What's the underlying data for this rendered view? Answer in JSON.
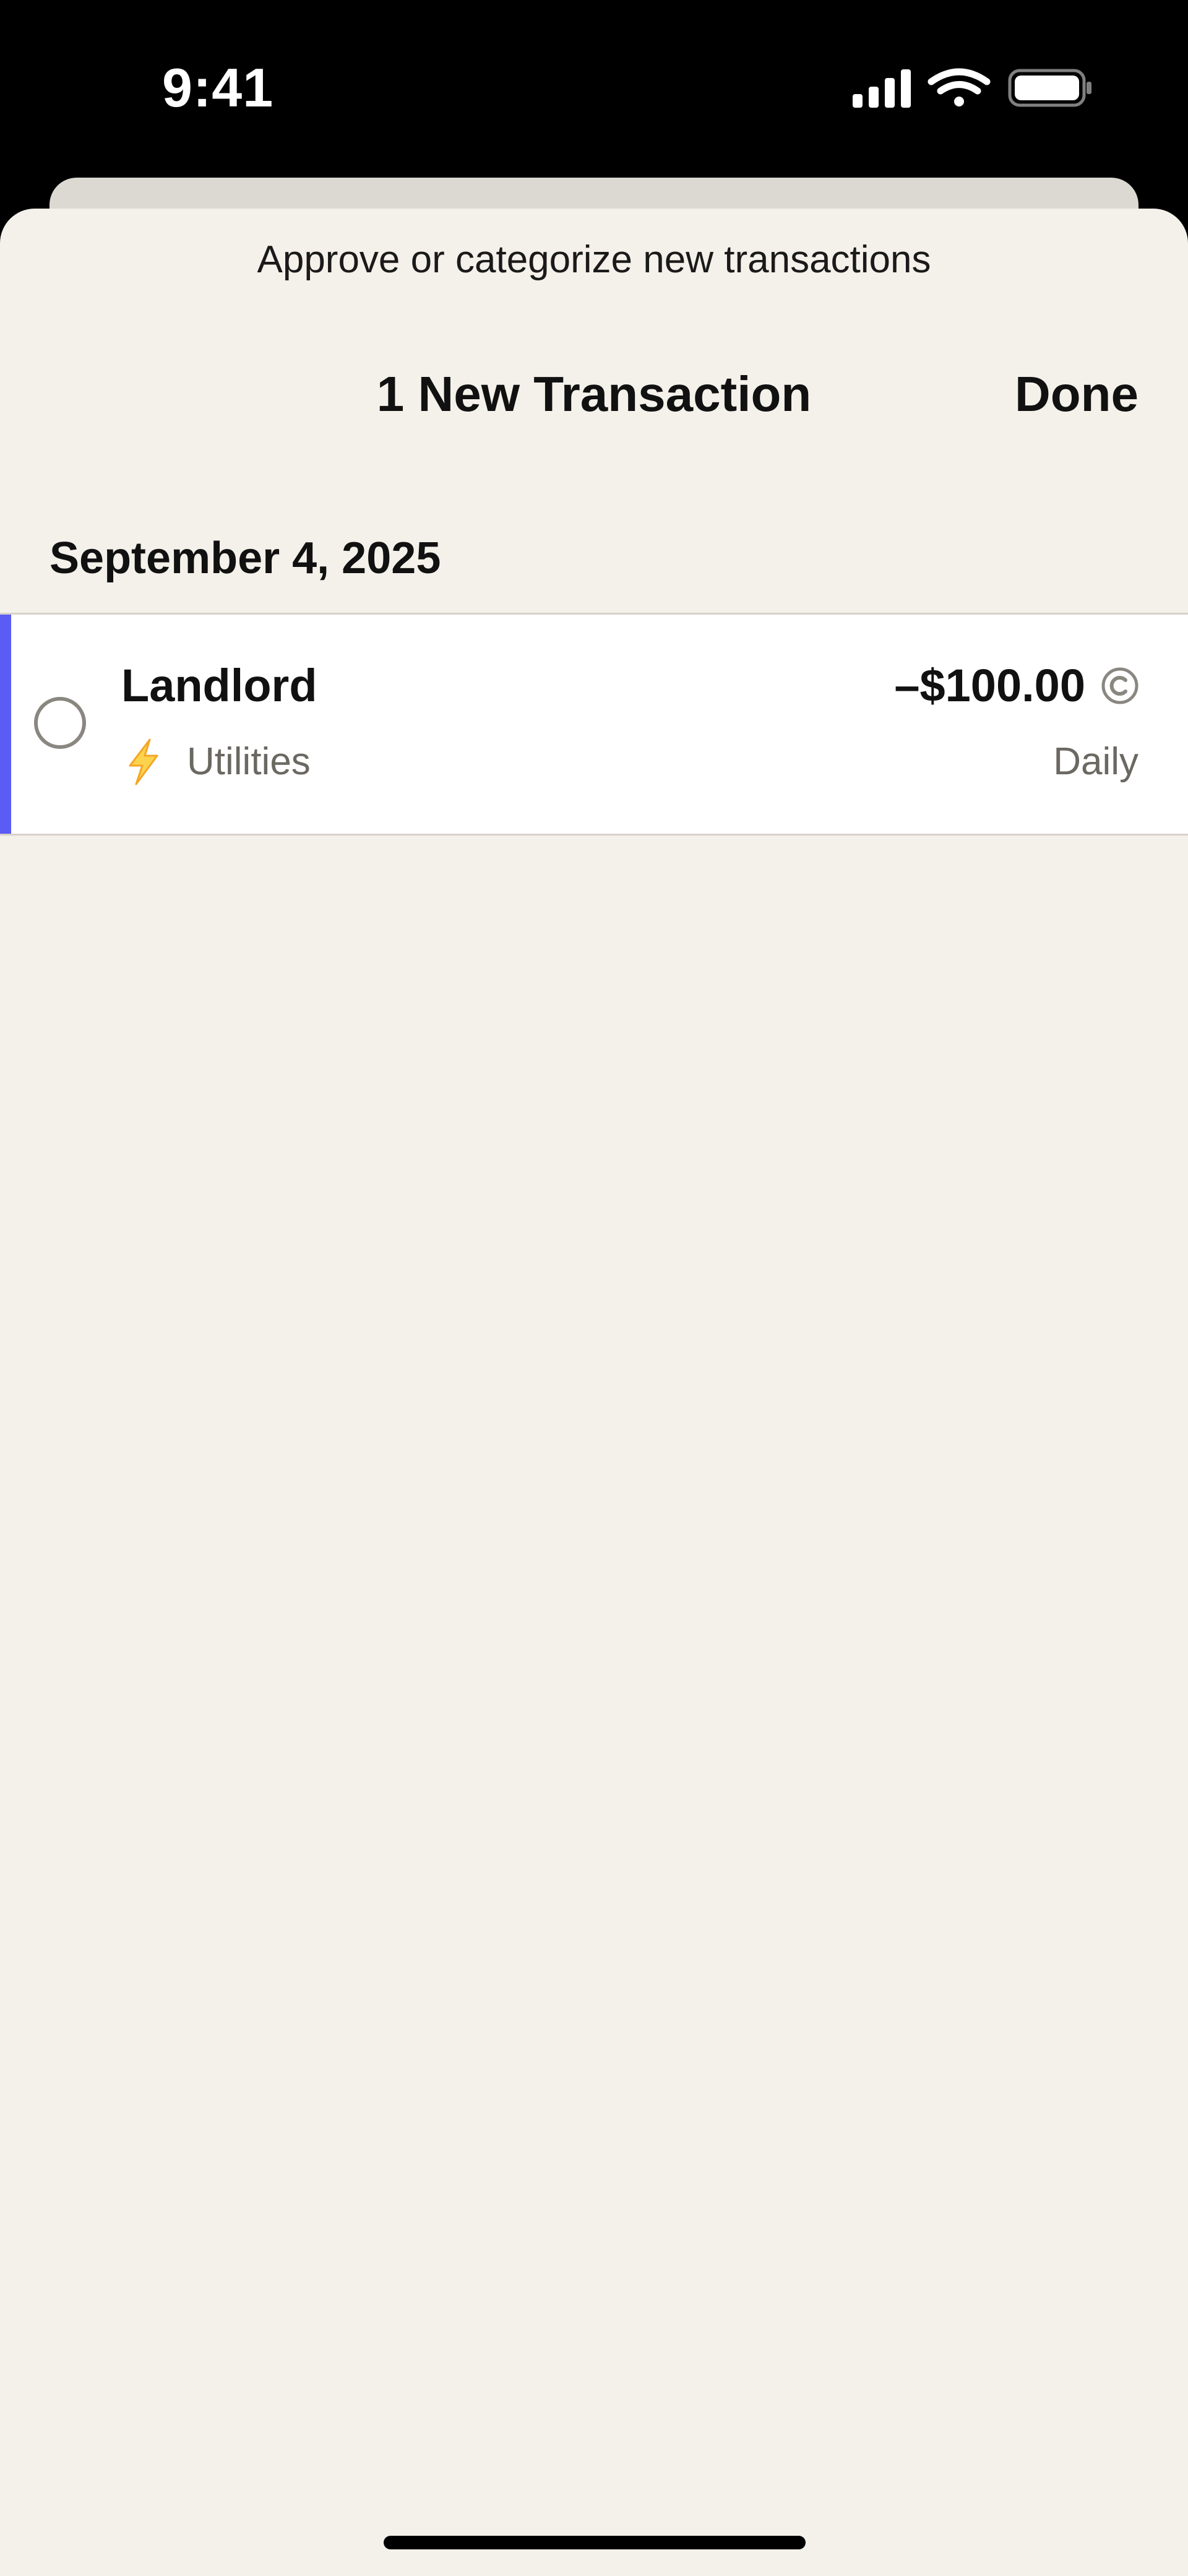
{
  "status_bar": {
    "time": "9:41",
    "icons": [
      "signal-icon",
      "wifi-icon",
      "battery-icon"
    ]
  },
  "sheet": {
    "subtitle": "Approve or categorize new transactions",
    "title": "1 New Transaction",
    "done_label": "Done"
  },
  "groups": [
    {
      "date": "September 4, 2025",
      "transactions": [
        {
          "merchant": "Landlord",
          "category": "Utilities",
          "category_icon": "bolt-icon",
          "amount": "–$100.00",
          "amount_icon": "copyright-icon",
          "frequency": "Daily",
          "accent_color": "#5b5bf5",
          "selected": false
        }
      ]
    }
  ],
  "colors": {
    "background": "#f4f1ea",
    "row_background": "#ffffff",
    "accent": "#5b5bf5",
    "bolt": "#f5b82e",
    "secondary_text": "#6b6862"
  }
}
